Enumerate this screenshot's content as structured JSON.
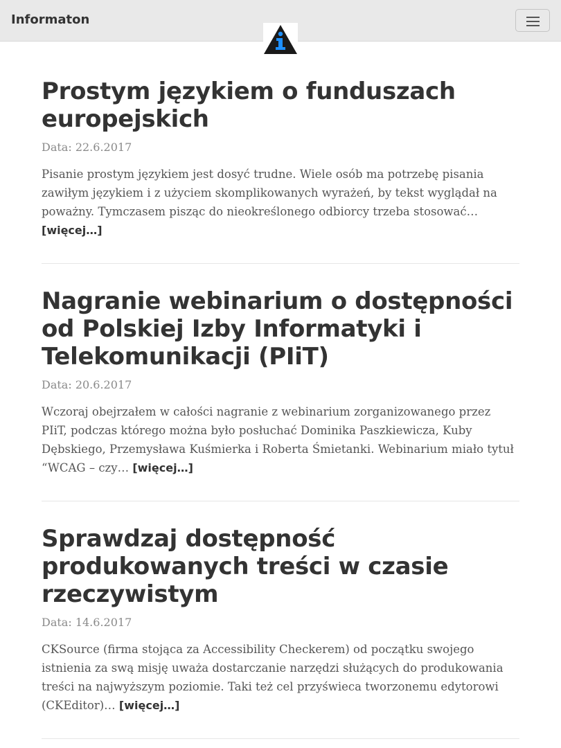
{
  "navbar": {
    "brand": "Informaton",
    "toggle_icon": "hamburger-menu-icon",
    "logo_icon": "info-triangle-logo"
  },
  "colors": {
    "navbar_bg": "#e9e9e9",
    "title": "#333333",
    "text": "#555555",
    "date": "#8a8a8a",
    "logo_triangle": "#1a1a1a",
    "logo_i": "#1e90ff"
  },
  "posts": [
    {
      "title": "Prostym językiem o funduszach europejskich",
      "date": "Data: 22.6.2017",
      "excerpt": "Pisanie prostym językiem jest dosyć trudne. Wiele osób ma potrzebę pisania zawiłym językiem i z użyciem skomplikowanych wyrażeń, by tekst wyglądał na poważny. Tymczasem pisząc do nieokreślonego odbiorcy trzeba stosować…",
      "more": "[więcej…]"
    },
    {
      "title": "Nagranie webinarium o dostępności od Polskiej Izby Informatyki i Telekomunikacji (PIiT)",
      "date": "Data: 20.6.2017",
      "excerpt": "Wczoraj obejrzałem w całości nagranie z webinarium zorganizowanego przez PIiT, podczas którego można było posłuchać Dominika Paszkiewicza, Kuby Dębskiego, Przemysława Kuśmierka i Roberta Śmietanki. Webinarium miało tytuł “WCAG – czy…",
      "more": "[więcej…]"
    },
    {
      "title": "Sprawdzaj dostępność produkowanych treści w czasie rzeczywistym",
      "date": "Data: 14.6.2017",
      "excerpt": "CKSource (firma stojąca za Accessibility Checkerem) od początku swojego istnienia za swą misję uważa dostarczanie narzędzi służących do produkowania treści na najwyższym poziomie. Taki też cel przyświeca tworzonemu edytorowi (CKEditor)…",
      "more": "[więcej…]"
    }
  ]
}
